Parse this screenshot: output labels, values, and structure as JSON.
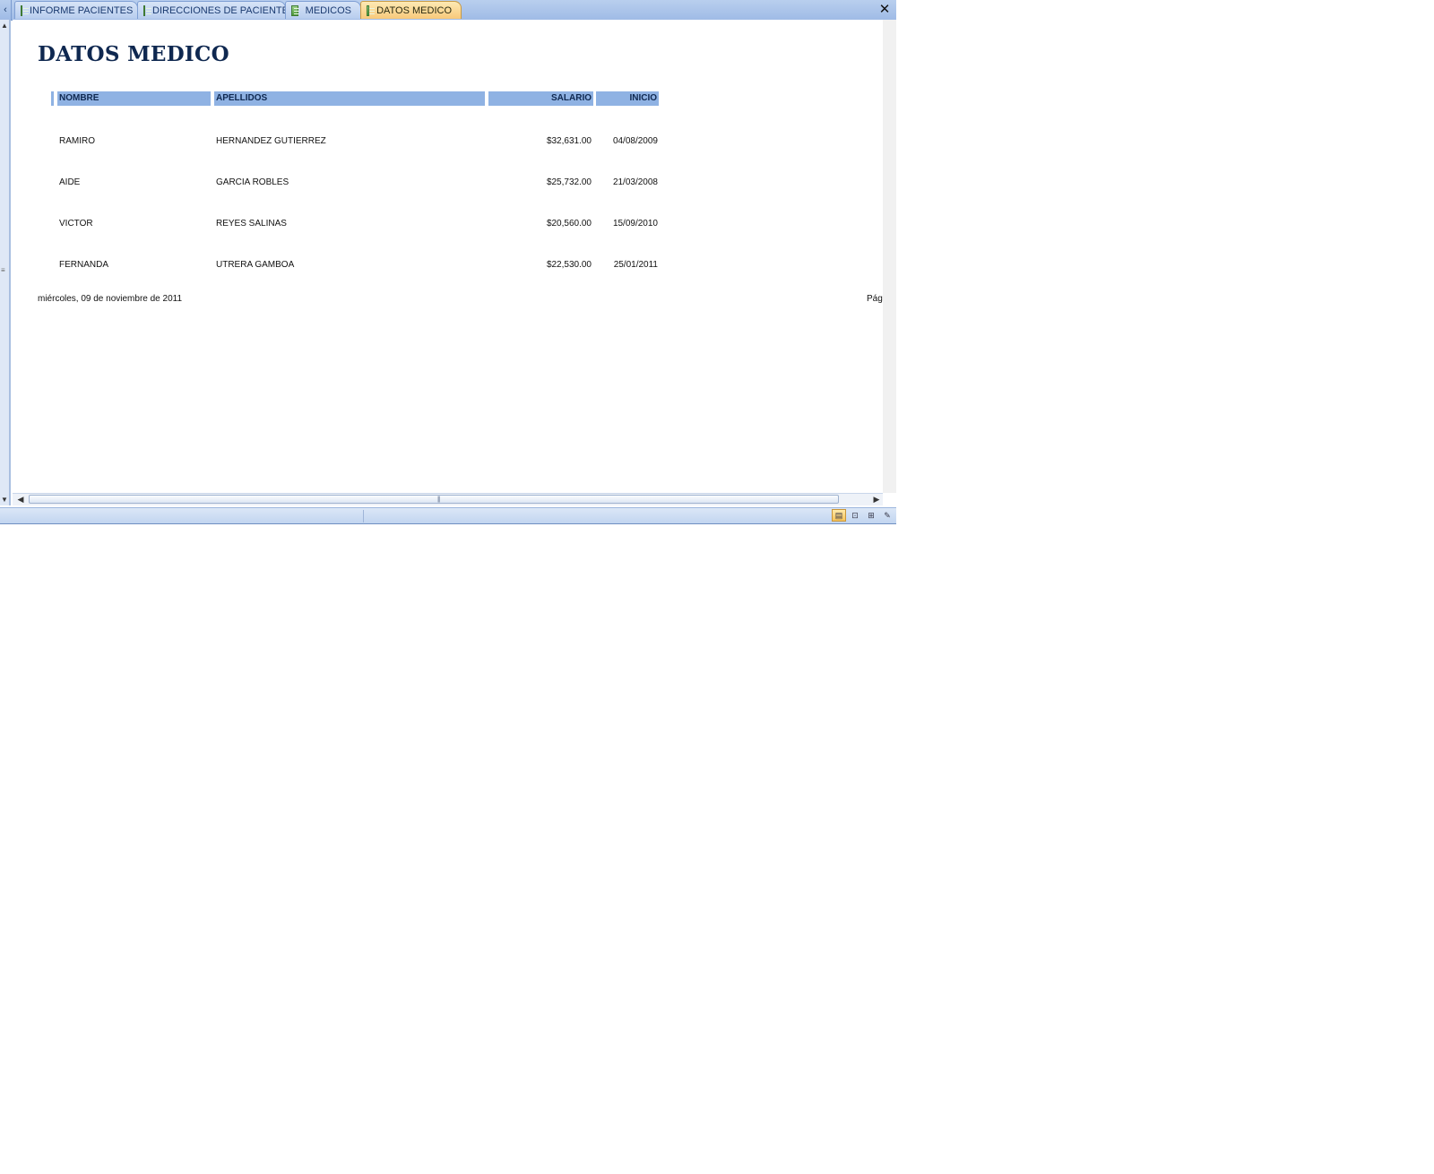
{
  "tabs": [
    {
      "label": "INFORME PACIENTES",
      "active": false
    },
    {
      "label": "DIRECCIONES DE PACIENTES",
      "active": false
    },
    {
      "label": "MEDICOS",
      "active": false
    },
    {
      "label": "DATOS MEDICO",
      "active": true
    }
  ],
  "report": {
    "title": "DATOS MEDICO",
    "columns": {
      "nombre": "NOMBRE",
      "apellidos": "APELLIDOS",
      "salario": "SALARIO",
      "inicio": "INICIO"
    },
    "rows": [
      {
        "nombre": "RAMIRO",
        "apellidos": "HERNANDEZ GUTIERREZ",
        "salario": "$32,631.00",
        "inicio": "04/08/2009"
      },
      {
        "nombre": "AIDE",
        "apellidos": "GARCIA ROBLES",
        "salario": "$25,732.00",
        "inicio": "21/03/2008"
      },
      {
        "nombre": "VICTOR",
        "apellidos": "REYES SALINAS",
        "salario": "$20,560.00",
        "inicio": "15/09/2010"
      },
      {
        "nombre": "FERNANDA",
        "apellidos": "UTRERA GAMBOA",
        "salario": "$22,530.00",
        "inicio": "25/01/2011"
      }
    ],
    "footer_date": "miércoles, 09 de noviembre de 2011",
    "footer_page": "Pág"
  },
  "icons": {
    "tab_icon": "report-icon",
    "close": "close-icon",
    "view_buttons": [
      "report-view-icon",
      "print-preview-icon",
      "layout-view-icon",
      "design-view-icon"
    ]
  }
}
